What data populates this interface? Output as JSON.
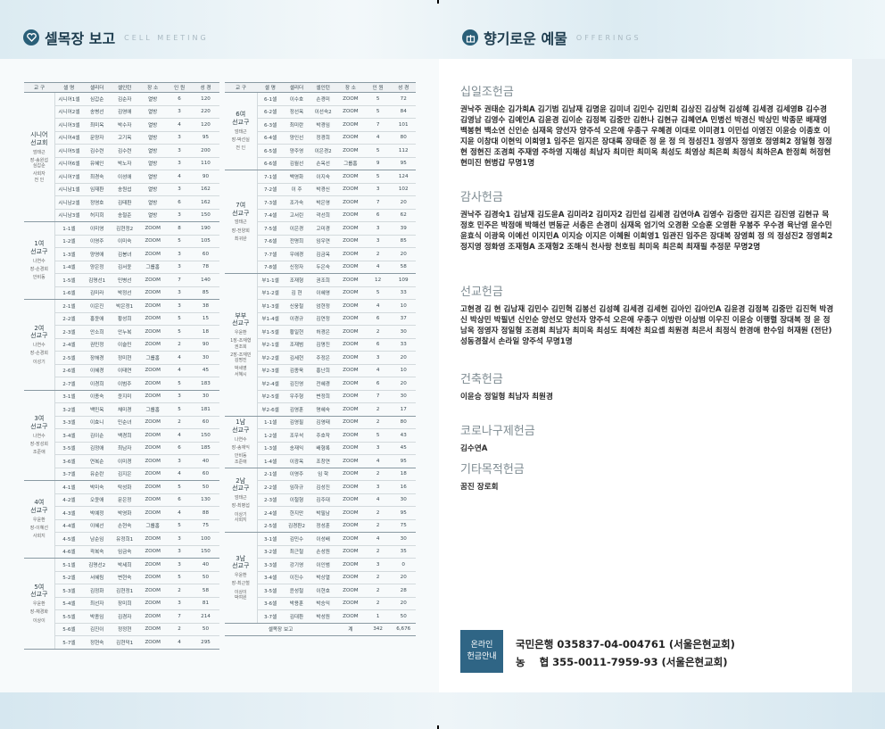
{
  "left_header": {
    "title": "셀목장 보고",
    "sub": "CELL MEETING"
  },
  "right_header": {
    "title": "향기로운 예물",
    "sub": "OFFERINGS"
  },
  "columns": [
    "교 구",
    "셀 명",
    "셀리더",
    "셀인턴",
    "장 소",
    "인 원",
    "성 경"
  ],
  "left_groups": [
    {
      "name": "시니어\n선교회",
      "leaders": [
        "엄태근",
        "장-송원섭\n심갑순",
        "사회자\n전 인"
      ],
      "rows": [
        [
          "시니어1셀",
          "심갑순",
          "김순자",
          "열방",
          "6",
          "120"
        ],
        [
          "시니어2셀",
          "송병선",
          "김영애",
          "열방",
          "3",
          "220"
        ],
        [
          "시니어3셀",
          "최미옥",
          "박수자",
          "열방",
          "4",
          "120"
        ],
        [
          "시니어4셀",
          "문양자",
          "고기옥",
          "열방",
          "3",
          "95"
        ],
        [
          "시니어5셀",
          "김수련",
          "김수련",
          "열방",
          "3",
          "200"
        ],
        [
          "시니어6셀",
          "유혜인",
          "박노자",
          "열방",
          "3",
          "110"
        ],
        [
          "시니어7셀",
          "최경숙",
          "이성애",
          "열방",
          "4",
          "90"
        ],
        [
          "시니남1셀",
          "임재환",
          "송원섭",
          "열방",
          "3",
          "162"
        ],
        [
          "시니남2셀",
          "정영호",
          "김태환",
          "열방",
          "6",
          "162"
        ],
        [
          "시니남3셀",
          "허지회",
          "송철준",
          "열방",
          "3",
          "150"
        ]
      ]
    },
    {
      "name": "1여\n선교구",
      "leaders": [
        "나연수",
        "장-손경희",
        "안비동"
      ],
      "rows": [
        [
          "1-1셀",
          "이미영",
          "김현정2",
          "ZOOM",
          "8",
          "190"
        ],
        [
          "1-2셀",
          "이영주",
          "이미숙",
          "ZOOM",
          "5",
          "105"
        ],
        [
          "1-3셀",
          "양영애",
          "김봉녀",
          "ZOOM",
          "3",
          "60"
        ],
        [
          "1-4셀",
          "양은정",
          "김서윤",
          "그룹홈",
          "3",
          "78"
        ],
        [
          "1-5셀",
          "김명선1",
          "민병선",
          "ZOOM",
          "7",
          "140"
        ],
        [
          "1-6셀",
          "김미라",
          "박정선",
          "ZOOM",
          "3",
          "85"
        ]
      ]
    },
    {
      "name": "2여\n선교구",
      "leaders": [
        "나연수",
        "장-손경희",
        "이성기"
      ],
      "rows": [
        [
          "2-1셀",
          "이은진",
          "박은정1",
          "ZOOM",
          "3",
          "38"
        ],
        [
          "2-2셀",
          "홍윤애",
          "황성희",
          "ZOOM",
          "5",
          "15"
        ],
        [
          "2-3셀",
          "안소희",
          "안누복",
          "ZOOM",
          "5",
          "18"
        ],
        [
          "2-4셀",
          "권민정",
          "이슬민",
          "ZOOM",
          "2",
          "90"
        ],
        [
          "2-5셀",
          "장해경",
          "정미현",
          "그룹홈",
          "4",
          "30"
        ],
        [
          "2-6셀",
          "이혜경",
          "이태연",
          "ZOOM",
          "4",
          "45"
        ],
        [
          "2-7셀",
          "이경희",
          "이범주",
          "ZOOM",
          "5",
          "183"
        ]
      ]
    },
    {
      "name": "3여\n선교구",
      "leaders": [
        "나연수",
        "장-장성희",
        "조준애"
      ],
      "rows": [
        [
          "3-1셀",
          "이종숙",
          "윤지미",
          "ZOOM",
          "3",
          "30"
        ],
        [
          "3-2셀",
          "백민옥",
          "채미경",
          "그룹홈",
          "5",
          "181"
        ],
        [
          "3-3셀",
          "이효니",
          "민순녀",
          "ZOOM",
          "2",
          "60"
        ],
        [
          "3-4셀",
          "김이순",
          "백경희",
          "ZOOM",
          "4",
          "150"
        ],
        [
          "3-5셀",
          "김정애",
          "최남자",
          "ZOOM",
          "6",
          "185"
        ],
        [
          "3-6셀",
          "연복순",
          "이미경",
          "ZOOM",
          "3",
          "40"
        ],
        [
          "3-7셀",
          "유순란",
          "김지은",
          "ZOOM",
          "4",
          "60"
        ]
      ]
    },
    {
      "name": "4여\n선교구",
      "leaders": [
        "우윤환",
        "장-이혜선",
        "사회지"
      ],
      "rows": [
        [
          "4-1셀",
          "박미숙",
          "탁성화",
          "ZOOM",
          "5",
          "50"
        ],
        [
          "4-2셀",
          "오윤애",
          "문은정",
          "ZOOM",
          "6",
          "130"
        ],
        [
          "4-3셀",
          "박예정",
          "박영화",
          "ZOOM",
          "4",
          "88"
        ],
        [
          "4-4셀",
          "이혜선",
          "손현숙",
          "그룹홈",
          "5",
          "75"
        ],
        [
          "4-5셀",
          "남순임",
          "유정희1",
          "ZOOM",
          "3",
          "100"
        ],
        [
          "4-6셀",
          "곽복숙",
          "임금숙",
          "ZOOM",
          "3",
          "150"
        ]
      ]
    },
    {
      "name": "5여\n선교구",
      "leaders": [
        "우윤환",
        "장-채경화",
        "이상이"
      ],
      "rows": [
        [
          "5-1셀",
          "김명선2",
          "박세희",
          "ZOOM",
          "3",
          "40"
        ],
        [
          "5-2셀",
          "서혜림",
          "변현숙",
          "ZOOM",
          "5",
          "50"
        ],
        [
          "5-3셀",
          "김정화",
          "김현정1",
          "ZOOM",
          "2",
          "58"
        ],
        [
          "5-4셀",
          "최선자",
          "장미희",
          "ZOOM",
          "3",
          "81"
        ],
        [
          "5-5셀",
          "박종임",
          "김경자",
          "ZOOM",
          "7",
          "214"
        ],
        [
          "5-6셀",
          "김진이",
          "정정현",
          "ZOOM",
          "2",
          "50"
        ],
        [
          "5-7셀",
          "정현숙",
          "김현덕1",
          "ZOOM",
          "4",
          "295"
        ]
      ]
    }
  ],
  "right_groups": [
    {
      "name": "6여\n선교구",
      "leaders": [
        "엄태근",
        "장-박선실",
        "전 인"
      ],
      "rows": [
        [
          "6-1셀",
          "이수호",
          "손경미",
          "ZOOM",
          "5",
          "72"
        ],
        [
          "6-2셀",
          "정선옥",
          "이선숙2",
          "ZOOM",
          "5",
          "84"
        ],
        [
          "6-3셀",
          "최미란",
          "박경임",
          "ZOOM",
          "7",
          "101"
        ],
        [
          "6-4셀",
          "양인선",
          "정경희",
          "ZOOM",
          "4",
          "80"
        ],
        [
          "6-5셀",
          "양주영",
          "이은경2",
          "ZOOM",
          "5",
          "112"
        ],
        [
          "6-6셀",
          "김월선",
          "손옥선",
          "그룹홈",
          "9",
          "95"
        ]
      ]
    },
    {
      "name": "7여\n선교구",
      "leaders": [
        "엄태근",
        "장-전양희",
        "최귀완"
      ],
      "rows": [
        [
          "7-1셀",
          "백영화",
          "이지숙",
          "ZOOM",
          "5",
          "124"
        ],
        [
          "7-2셀",
          "이 주",
          "박경신",
          "ZOOM",
          "3",
          "102"
        ],
        [
          "7-3셀",
          "조가숙",
          "박은영",
          "ZOOM",
          "7",
          "20"
        ],
        [
          "7-4셀",
          "고서린",
          "곽선희",
          "ZOOM",
          "6",
          "62"
        ],
        [
          "7-5셀",
          "이은경",
          "고미경",
          "ZOOM",
          "3",
          "39"
        ],
        [
          "7-6셀",
          "전명희",
          "임우연",
          "ZOOM",
          "3",
          "85"
        ],
        [
          "7-7셀",
          "우애경",
          "김금옥",
          "ZOOM",
          "2",
          "20"
        ],
        [
          "7-8셀",
          "신정자",
          "두은숙",
          "ZOOM",
          "4",
          "58"
        ]
      ]
    },
    {
      "name": "부부\n선교구",
      "leaders": [
        "우윤환",
        "1장-조재형\n권조희",
        "2장-조재민\n김명진",
        "박세영\n서혜시"
      ],
      "rows": [
        [
          "부1-1셀",
          "조재형",
          "권조희",
          "ZOOM",
          "12",
          "109"
        ],
        [
          "부1-2셀",
          "김 현",
          "이혜영",
          "ZOOM",
          "5",
          "33"
        ],
        [
          "부1-3셀",
          "신웅철",
          "엄현정",
          "ZOOM",
          "4",
          "10"
        ],
        [
          "부1-4셀",
          "이경규",
          "김연정",
          "ZOOM",
          "6",
          "37"
        ],
        [
          "부1-5셀",
          "황일현",
          "허경은",
          "ZOOM",
          "2",
          "30"
        ],
        [
          "부2-1셀",
          "조재범",
          "김명진",
          "ZOOM",
          "6",
          "33"
        ],
        [
          "부2-2셀",
          "김세현",
          "주정은",
          "ZOOM",
          "3",
          "20"
        ],
        [
          "부2-3셀",
          "김종욱",
          "홍난희",
          "ZOOM",
          "4",
          "10"
        ],
        [
          "부2-4셀",
          "김진영",
          "전혜경",
          "ZOOM",
          "6",
          "20"
        ],
        [
          "부2-5셀",
          "우주형",
          "변정희",
          "ZOOM",
          "7",
          "30"
        ],
        [
          "부2-6셀",
          "김영훈",
          "명혜숙",
          "ZOOM",
          "2",
          "17"
        ]
      ]
    },
    {
      "name": "1남\n선교구",
      "leaders": [
        "나연수",
        "장-송재익",
        "안비동\n조준애"
      ],
      "rows": [
        [
          "1-1셀",
          "김영필",
          "김영태",
          "ZOOM",
          "2",
          "80"
        ],
        [
          "1-2셀",
          "조우석",
          "주호작",
          "ZOOM",
          "5",
          "43"
        ],
        [
          "1-3셀",
          "송재익",
          "배형록",
          "ZOOM",
          "3",
          "45"
        ],
        [
          "1-4셀",
          "이광옥",
          "조창연",
          "ZOOM",
          "4",
          "95"
        ]
      ]
    },
    {
      "name": "2남\n선교구",
      "leaders": [
        "엄태근",
        "장-최병섭",
        "이상기\n사회지"
      ],
      "rows": [
        [
          "2-1셀",
          "이영주",
          "임 학",
          "ZOOM",
          "2",
          "18"
        ],
        [
          "2-2셀",
          "임하규",
          "김성진",
          "ZOOM",
          "3",
          "16"
        ],
        [
          "2-3셀",
          "이철형",
          "김주대",
          "ZOOM",
          "4",
          "30"
        ],
        [
          "2-4셀",
          "한지만",
          "박필남",
          "ZOOM",
          "2",
          "95"
        ],
        [
          "2-5셀",
          "김경환2",
          "정성훈",
          "ZOOM",
          "2",
          "75"
        ]
      ]
    },
    {
      "name": "3남\n선교구",
      "leaders": [
        "우윤환",
        "장-최근철",
        "이상이\n박여원"
      ],
      "rows": [
        [
          "3-1셀",
          "김민수",
          "이성배",
          "ZOOM",
          "4",
          "30"
        ],
        [
          "3-2셀",
          "최근철",
          "손성원",
          "ZOOM",
          "2",
          "35"
        ],
        [
          "3-3셀",
          "강기영",
          "이인범",
          "ZOOM",
          "3",
          "0"
        ],
        [
          "3-4셀",
          "이진수",
          "박상열",
          "ZOOM",
          "2",
          "20"
        ],
        [
          "3-5셀",
          "윤성철",
          "이현호",
          "ZOOM",
          "2",
          "28"
        ],
        [
          "3-6셀",
          "박용훈",
          "박승익",
          "ZOOM",
          "2",
          "20"
        ],
        [
          "3-7셀",
          "김대환",
          "박성원",
          "ZOOM",
          "1",
          "50"
        ]
      ]
    }
  ],
  "totals": {
    "label": "셀목장 보고",
    "sum_label": "계",
    "people": "342",
    "bible": "6,676"
  },
  "offerings": [
    {
      "title": "십일조헌금",
      "body": "권낙주 권태순 김가희A 김기범 김남재 김명윤 김미녀 김민수 김민희 김상진 김상혁 김성혜 김세경 김세영B 김수경 김영남 김영수 김예인A 김윤경 김이순 김정복 김중만 김한나 김현규 김혜연A 민병선 박경신 박상민 박종문 배재영 백봉현 백소연 신인순 심재옥 양선자 양주석 오은애 우종구 우혜경 이대로 이미경1 이민섭 이영진 이윤승 이종호 이지윤 이창대 이현익 이희영1 임주은 임지은 장대록 장태준 정 윤 정 의 정성진1 정영자 정영호 정영희2 정일형 정정현 정현진 조경희 주재영 주하영 지해성 최남자 최미란 최미옥 최성도 최영상 최은희 최정식 최하은A 한정희 허정현 현미진 현병갑 무명1명"
    },
    {
      "title": "감사헌금",
      "body": "권낙주 김경숙1 김남재 김도윤A 김미라2 김미자2 김민섭 김세경 김연아A 김영수 김중만 김지은 김진영 김현규 목정호 민주은 박정애 박해선 변동균 서충은 손경미 심재옥 엄기억 오경환 오승훈 오영환 우봉주 우수경 육난영 윤수민 윤효식 이광옥 이예선 이지민A 이지승 이지은 이혜원 이희영1 임관진 임주은 장대복 장영희 정 의 정성진2 정영희2 정지영 정화영 조재형A 조재형2 조해식 천사랑 천호림 최미옥 최은희 최재필 추정문 무명2명"
    },
    {
      "title": "선교헌금",
      "body": "고현경 김 현 김남재 김민수 김민혁 김봉선 김성혜 김세경 김세현 김아인 김아인A 김윤경 김정복 김중만 김진혁 박경신 박상민 박필년 신인순 양선모 양선자 양주석 오은애 우종구 이방란 이상범 이우진 이윤승 이행렬 장대복 정 윤 정남옥 정영자 정일형 조경희 최남자 최미옥 최성도 최예찬 최요셉 최원경 최은서 최정식 한경애 한수임 허재원 (전단)성동경찰서 손라일 양주석 무명1명"
    },
    {
      "title": "건축헌금",
      "body": "이윤승 정일형 최남자 최원경"
    },
    {
      "title": "코로나구제헌금",
      "body": "김수연A"
    },
    {
      "title": "기타목적헌금",
      "body": "꿈진 장로회"
    }
  ],
  "bank": {
    "badge_line1": "온라인",
    "badge_line2": "헌금안내",
    "line1": "국민은행 035837-04-004761 (서울은현교회)",
    "line2": "농    협 355-0011-7959-93 (서울은현교회)"
  }
}
